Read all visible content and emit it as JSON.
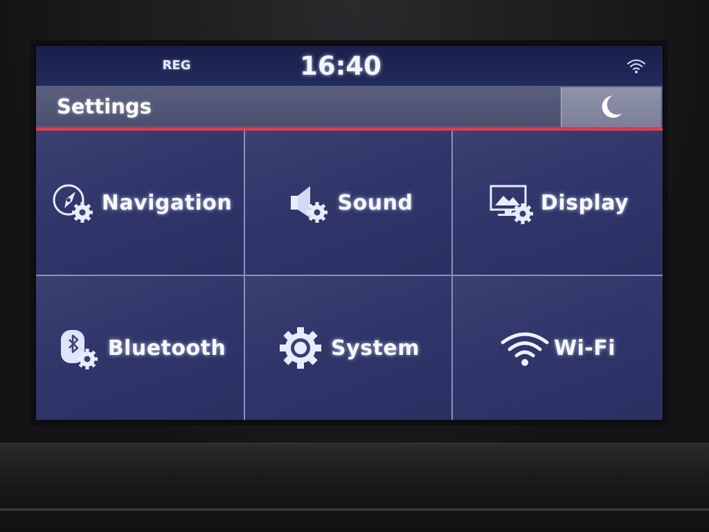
{
  "status_bar": {
    "reg_label": "REG",
    "time": "16:40",
    "signal_icon": "wifi-signal-icon"
  },
  "header": {
    "title": "Settings",
    "night_mode_icon": "moon-icon"
  },
  "colors": {
    "accent_line": "#e33a4a",
    "screen_bg": "#2a3062",
    "title_bar": "#4a4f70",
    "text": "#f6f7ff"
  },
  "menu": {
    "items": [
      {
        "label": "Navigation",
        "icon": "navigation-settings-icon"
      },
      {
        "label": "Sound",
        "icon": "sound-settings-icon"
      },
      {
        "label": "Display",
        "icon": "display-settings-icon"
      },
      {
        "label": "Bluetooth",
        "icon": "bluetooth-settings-icon"
      },
      {
        "label": "System",
        "icon": "system-gear-icon"
      },
      {
        "label": "Wi-Fi",
        "icon": "wifi-icon"
      }
    ]
  }
}
